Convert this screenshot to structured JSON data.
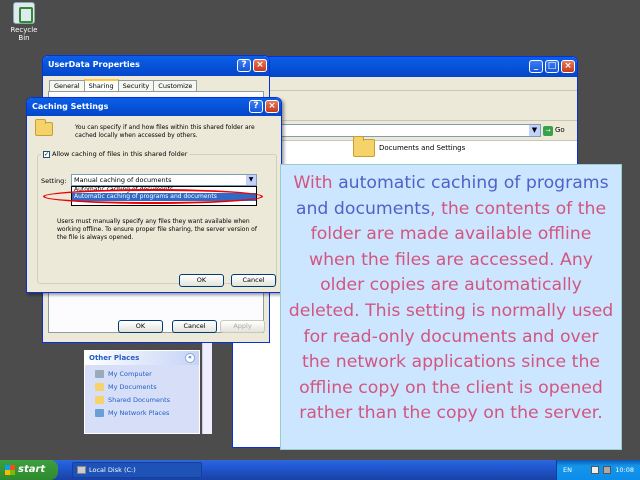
{
  "desktop": {
    "recycle_bin_label": "Recycle Bin"
  },
  "explorer": {
    "go_label": "Go",
    "folder_label": "Documents and Settings",
    "other_places": {
      "title": "Other Places",
      "items": [
        "My Computer",
        "My Documents",
        "Shared Documents",
        "My Network Places"
      ]
    }
  },
  "props_dialog": {
    "title": "UserData Properties",
    "tabs": [
      "General",
      "Sharing",
      "Security",
      "Customize"
    ],
    "ok_label": "OK",
    "cancel_label": "Cancel",
    "apply_label": "Apply"
  },
  "caching_dialog": {
    "title": "Caching Settings",
    "description": "You can specify if and how files within this shared folder are cached locally when accessed by others.",
    "allow_label": "Allow caching of files in this shared folder",
    "setting_label": "Setting:",
    "setting_value": "Manual caching of documents",
    "options": [
      "Automatic caching of documents",
      "Automatic caching of programs and documents"
    ],
    "users_text": "Users must manually specify any files they want available when working offline. To ensure proper file sharing, the server version of the file is always opened.",
    "ok_label": "OK",
    "cancel_label": "Cancel"
  },
  "callout": {
    "part1": "With ",
    "highlight1": "automatic caching of programs and documents",
    "part2": ", the contents of the folder are made available offline when the files are accessed. Any older copies are automatically deleted. This setting is normally used for read-only documents and over the network applications since the offline copy on the client is opened rather than the copy on the server.",
    "text_color": "#d2567f",
    "highlight_color": "#4f62c8",
    "background": "#cce6ff"
  },
  "taskbar": {
    "start_label": "start",
    "task_item": "Local Disk (C:)",
    "language": "EN",
    "clock": "10:08"
  }
}
